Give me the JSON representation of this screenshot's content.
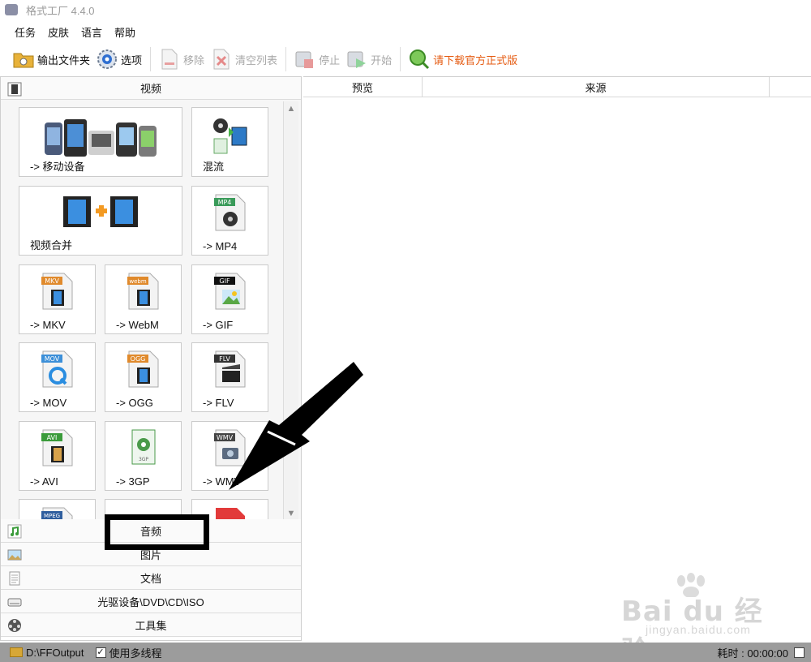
{
  "window": {
    "title": "格式工厂 4.4.0"
  },
  "menu": [
    "任务",
    "皮肤",
    "语言",
    "帮助"
  ],
  "toolbar": {
    "output_folder": "输出文件夹",
    "options": "选项",
    "remove": "移除",
    "clear_list": "清空列表",
    "stop": "停止",
    "start": "开始",
    "download": "请下载官方正式版"
  },
  "categories": {
    "video": "视频",
    "audio": "音频",
    "image": "图片",
    "document": "文档",
    "disc": "光驱设备\\DVD\\CD\\ISO",
    "tools": "工具集"
  },
  "video_tiles": [
    {
      "label": "-> 移动设备",
      "icon": "mobile-devices-icon"
    },
    {
      "label": "混流",
      "icon": "mux-icon"
    },
    {
      "label": "视频合并",
      "icon": "video-join-icon"
    },
    {
      "label": "-> MP4",
      "icon": "mp4-file-icon",
      "badge": "MP4"
    },
    {
      "label": "-> MKV",
      "icon": "mkv-file-icon",
      "badge": "MKV"
    },
    {
      "label": "-> WebM",
      "icon": "webm-file-icon",
      "badge": "webm"
    },
    {
      "label": "-> GIF",
      "icon": "gif-file-icon",
      "badge": "GIF"
    },
    {
      "label": "-> MOV",
      "icon": "mov-file-icon",
      "badge": "MOV"
    },
    {
      "label": "-> OGG",
      "icon": "ogg-file-icon",
      "badge": "OGG"
    },
    {
      "label": "-> FLV",
      "icon": "flv-file-icon",
      "badge": "FLV"
    },
    {
      "label": "-> AVI",
      "icon": "avi-file-icon",
      "badge": "AVI"
    },
    {
      "label": "-> 3GP",
      "icon": "3gp-file-icon",
      "badge": "3GP"
    },
    {
      "label": "-> WMV",
      "icon": "wmv-file-icon",
      "badge": "WMV"
    }
  ],
  "partial_tiles": [
    {
      "badge": "MPEG"
    }
  ],
  "task_table": {
    "columns": [
      "预览",
      "来源"
    ]
  },
  "statusbar": {
    "output_path": "D:\\FFOutput",
    "multithread_label": "使用多线程",
    "elapsed": "耗时 : 00:00:00"
  },
  "watermark": {
    "main": "Bai du 经验",
    "sub": "jingyan.baidu.com"
  },
  "colors": {
    "download_text": "#e55a10",
    "statusbar_bg": "#9c9c9c",
    "disabled_text": "#a8a8a8"
  }
}
